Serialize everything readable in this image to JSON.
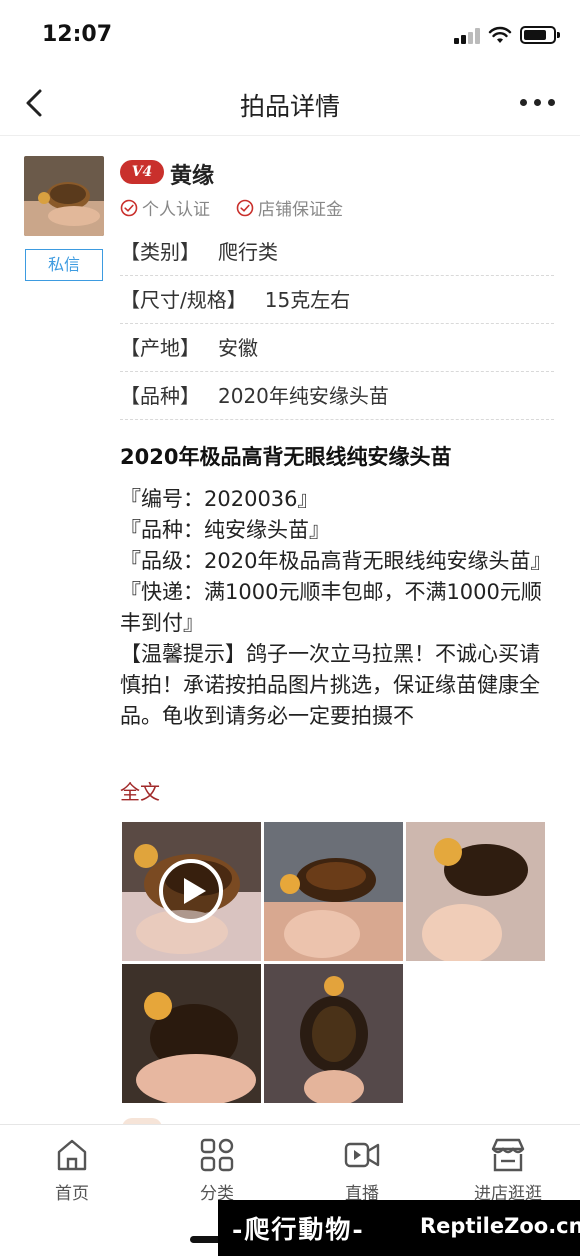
{
  "status_bar": {
    "time": "12:07"
  },
  "nav": {
    "title": "拍品详情"
  },
  "seller": {
    "level": "V4",
    "name": "黄缘",
    "certs": [
      "个人认证",
      "店铺保证金"
    ],
    "message_label": "私信"
  },
  "specs": [
    {
      "key": "【类别】",
      "value": "爬行类"
    },
    {
      "key": "【尺寸/规格】",
      "value": "15克左右"
    },
    {
      "key": "【产地】",
      "value": "安徽"
    },
    {
      "key": "【品种】",
      "value": "2020年纯安缘头苗"
    }
  ],
  "item": {
    "title": "2020年极品高背无眼线纯安缘头苗",
    "description": [
      "『编号：2020036』",
      "『品种：纯安缘头苗』",
      "『品级：2020年极品高背无眼线纯安缘头苗』",
      "『快递：满1000元顺丰包邮，不满1000元顺丰到付』",
      "【温馨提示】鸽子一次立马拉黑！不诚心买请慎拍！承诺按拍品图片挑选，保证缘苗健康全品。龟收到请务必一定要拍摄不"
    ],
    "full_text_label": "全文"
  },
  "gallery": {
    "photos": [
      {
        "name": "photo-1-video",
        "has_play": true
      },
      {
        "name": "photo-2",
        "has_play": false
      },
      {
        "name": "photo-3",
        "has_play": false
      },
      {
        "name": "photo-4",
        "has_play": false
      },
      {
        "name": "photo-5",
        "has_play": false
      }
    ]
  },
  "tab_bar": {
    "items": [
      {
        "label": "首页",
        "icon": "home-icon"
      },
      {
        "label": "分类",
        "icon": "grid-icon"
      },
      {
        "label": "直播",
        "icon": "video-icon"
      },
      {
        "label": "进店逛逛",
        "icon": "store-icon"
      }
    ]
  },
  "watermark": {
    "cn": "-爬行動物-",
    "en": "ReptileZoo.cn"
  },
  "colors": {
    "accent_red": "#c9302c",
    "link_blue": "#3d9be0",
    "full_text_red": "#a12a2a"
  }
}
